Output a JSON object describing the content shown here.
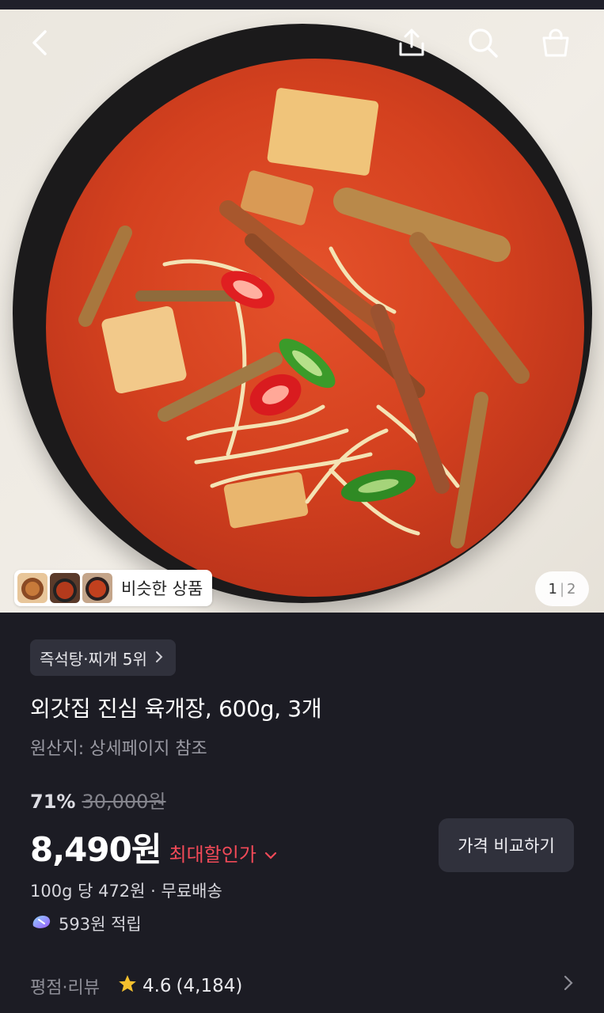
{
  "similar": {
    "label": "비슷한 상품"
  },
  "pager": {
    "current": "1",
    "separator": "|",
    "total": "2"
  },
  "product": {
    "rank_badge": "즉석탕·찌개 5위",
    "title": "외갓집 진심 육개장, 600g, 3개",
    "origin": "원산지: 상세페이지 참조",
    "discount_percent": "71%",
    "original_price": "30,000원",
    "price": "8,490원",
    "best_price_label": "최대할인가",
    "compare_button": "가격 비교하기",
    "unit_price_shipping": "100g 당 472원 · 무료배송",
    "points": "593원 적립"
  },
  "reviews": {
    "label": "평점·리뷰",
    "rating": "4.6",
    "count": "(4,184)"
  },
  "icons": [
    "back-icon",
    "share-icon",
    "search-icon",
    "cart-icon",
    "chevron-right-icon",
    "chevron-down-icon",
    "points-icon",
    "star-icon"
  ],
  "colors": {
    "accent_red": "#f24a58",
    "background": "#1c1c24",
    "chip": "#30313c",
    "star": "#f5c02e"
  }
}
